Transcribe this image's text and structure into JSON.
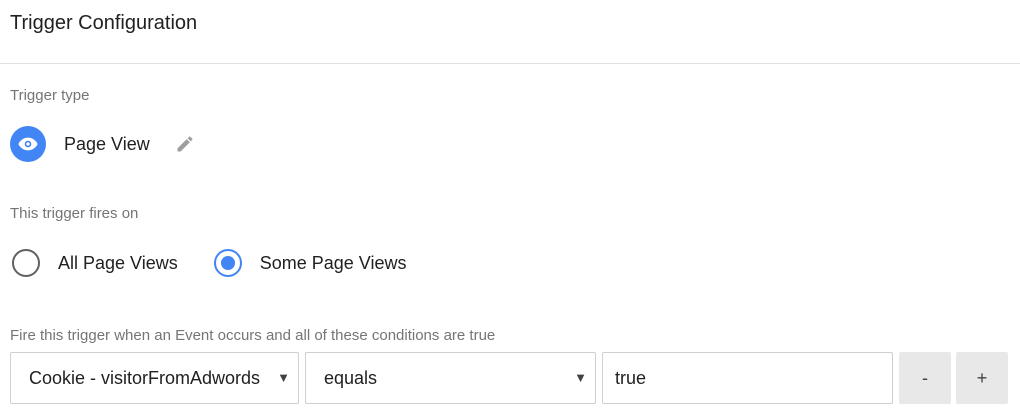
{
  "header": {
    "title": "Trigger Configuration"
  },
  "trigger_type": {
    "label": "Trigger type",
    "name": "Page View",
    "icon": "eye-icon",
    "edit_icon": "pencil-icon",
    "accent_color": "#4285f4"
  },
  "fires_on": {
    "label": "This trigger fires on",
    "options": [
      {
        "label": "All Page Views",
        "checked": false
      },
      {
        "label": "Some Page Views",
        "checked": true
      }
    ]
  },
  "conditions": {
    "label": "Fire this trigger when an Event occurs and all of these conditions are true",
    "variable": "Cookie - visitorFromAdwords",
    "operator": "equals",
    "value": "true",
    "remove_label": "-",
    "add_label": "+",
    "dropdown_icon": "caret-down-icon"
  }
}
